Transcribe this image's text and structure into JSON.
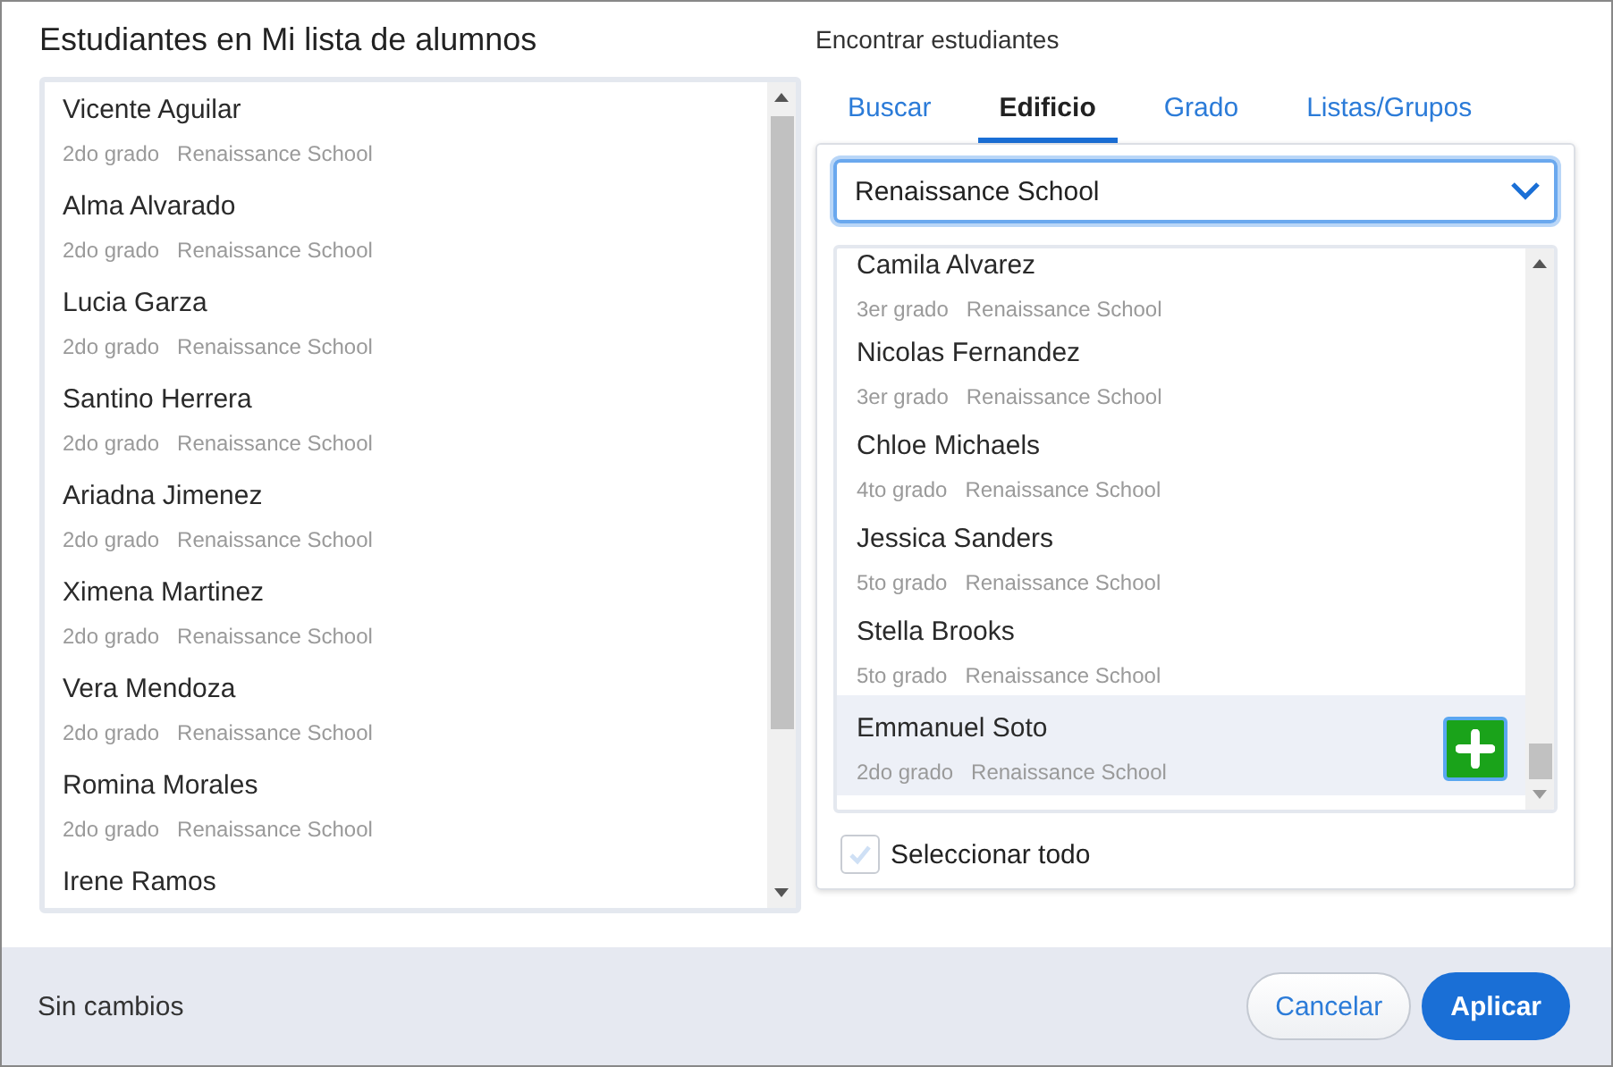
{
  "left": {
    "title": "Estudiantes en Mi lista de alumnos",
    "students": [
      {
        "name": "Vicente Aguilar",
        "grade": "2do grado",
        "school": "Renaissance School"
      },
      {
        "name": "Alma Alvarado",
        "grade": "2do grado",
        "school": "Renaissance School"
      },
      {
        "name": "Lucia Garza",
        "grade": "2do grado",
        "school": "Renaissance School"
      },
      {
        "name": "Santino Herrera",
        "grade": "2do grado",
        "school": "Renaissance School"
      },
      {
        "name": "Ariadna Jimenez",
        "grade": "2do grado",
        "school": "Renaissance School"
      },
      {
        "name": "Ximena Martinez",
        "grade": "2do grado",
        "school": "Renaissance School"
      },
      {
        "name": "Vera Mendoza",
        "grade": "2do grado",
        "school": "Renaissance School"
      },
      {
        "name": "Romina Morales",
        "grade": "2do grado",
        "school": "Renaissance School"
      },
      {
        "name": "Irene Ramos"
      }
    ]
  },
  "right": {
    "title": "Encontrar estudiantes",
    "tabs": [
      {
        "label": "Buscar",
        "selected": false
      },
      {
        "label": "Edificio",
        "selected": true
      },
      {
        "label": "Grado",
        "selected": false
      },
      {
        "label": "Listas/Grupos",
        "selected": false
      }
    ],
    "building_select": {
      "value": "Renaissance School"
    },
    "students": [
      {
        "name": "Camila Alvarez",
        "grade": "3er grado",
        "school": "Renaissance School",
        "selected": false
      },
      {
        "name": "Nicolas Fernandez",
        "grade": "3er grado",
        "school": "Renaissance School",
        "selected": false
      },
      {
        "name": "Chloe Michaels",
        "grade": "4to grado",
        "school": "Renaissance School",
        "selected": false
      },
      {
        "name": "Jessica Sanders",
        "grade": "5to grado",
        "school": "Renaissance School",
        "selected": false
      },
      {
        "name": "Stella Brooks",
        "grade": "5to grado",
        "school": "Renaissance School",
        "selected": false
      },
      {
        "name": "Emmanuel Soto",
        "grade": "2do grado",
        "school": "Renaissance School",
        "selected": true
      }
    ],
    "select_all": {
      "label": "Seleccionar todo",
      "checked": false
    }
  },
  "footer": {
    "status": "Sin cambios",
    "buttons": [
      {
        "label": "Cancelar",
        "kind": "secondary"
      },
      {
        "label": "Aplicar",
        "kind": "primary"
      }
    ]
  }
}
